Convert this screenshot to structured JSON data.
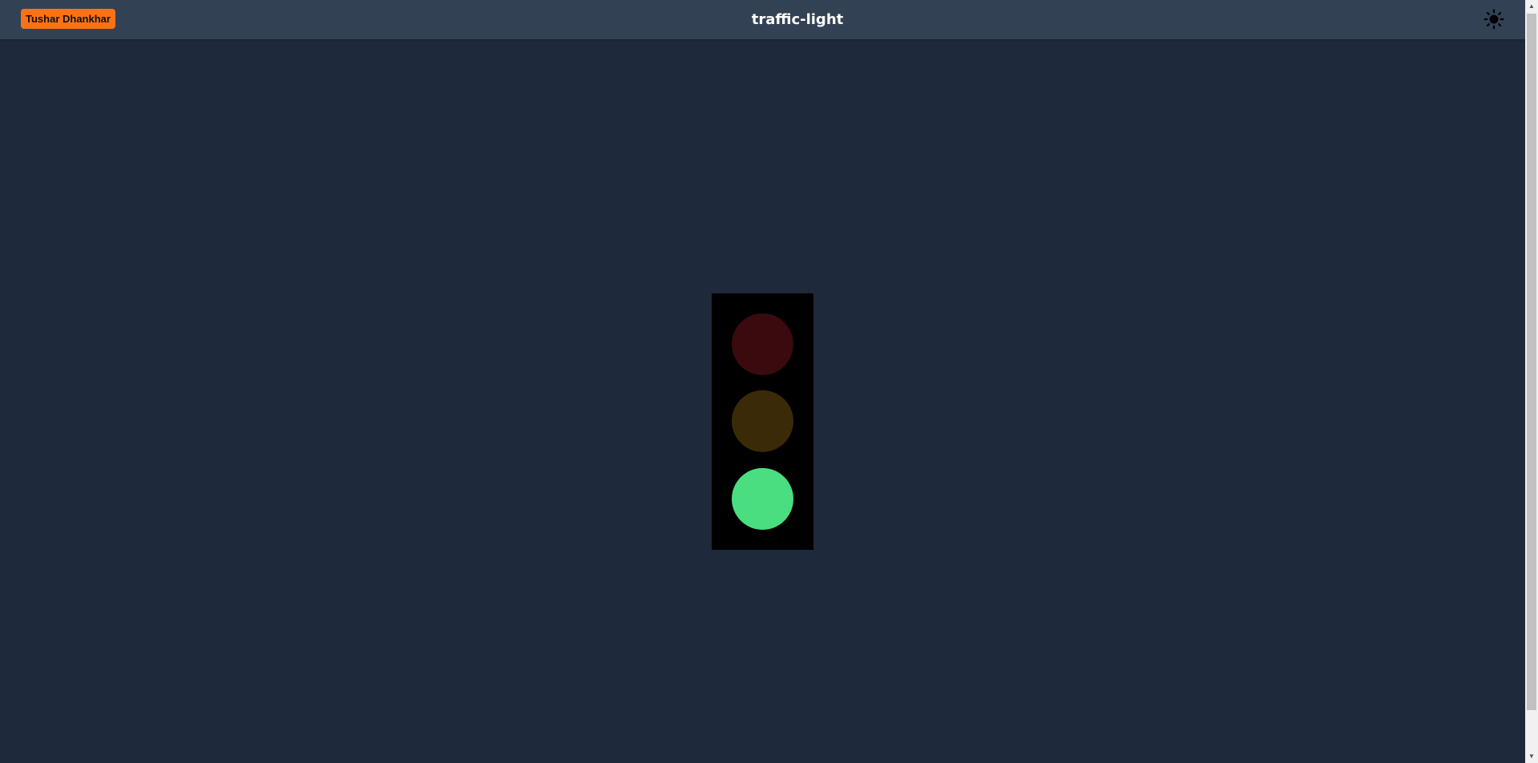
{
  "header": {
    "author": "Tushar Dhankhar",
    "title": "traffic-light",
    "theme_icon": "sun-icon"
  },
  "traffic_light": {
    "housing_color": "#000000",
    "active_light": "green",
    "lights": [
      {
        "name": "red",
        "state": "off",
        "color": "#3a0a0e"
      },
      {
        "name": "yellow",
        "state": "off",
        "color": "#3b2a07"
      },
      {
        "name": "green",
        "state": "on",
        "color": "#4ade80"
      }
    ]
  },
  "colors": {
    "page_background": "#1e293b",
    "header_background": "#334155",
    "badge_background": "#f97316",
    "title_text": "#ffffff"
  },
  "scrollbar": {
    "up_icon": "triangle-up-icon",
    "down_icon": "triangle-down-icon"
  }
}
